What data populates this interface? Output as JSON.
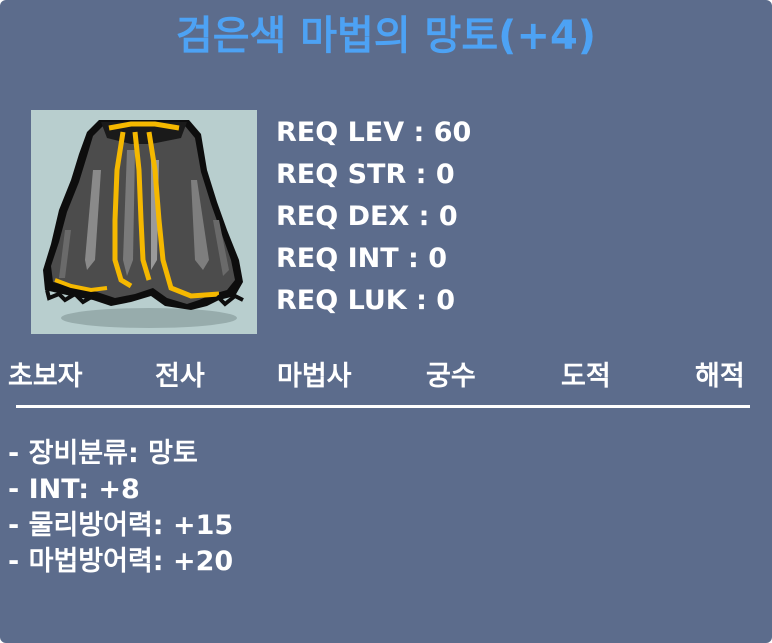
{
  "item": {
    "name": "검은색 마법의 망토(+4)",
    "icon": "black-cape-icon",
    "title_color": "#4da2f4"
  },
  "requirements": [
    "REQ LEV : 60",
    "REQ STR : 0",
    "REQ DEX : 0",
    "REQ INT : 0",
    "REQ LUK : 0"
  ],
  "jobs": [
    "초보자",
    "전사",
    "마법사",
    "궁수",
    "도적",
    "해적"
  ],
  "stats": [
    "- 장비분류: 망토",
    "- INT: +8",
    "- 물리방어력: +15",
    "- 마법방어력: +20"
  ],
  "colors": {
    "panel_bg": "#5c6c8c",
    "icon_bg": "#b8cece",
    "text": "#ffffff",
    "cape_trim": "#f5b800"
  }
}
